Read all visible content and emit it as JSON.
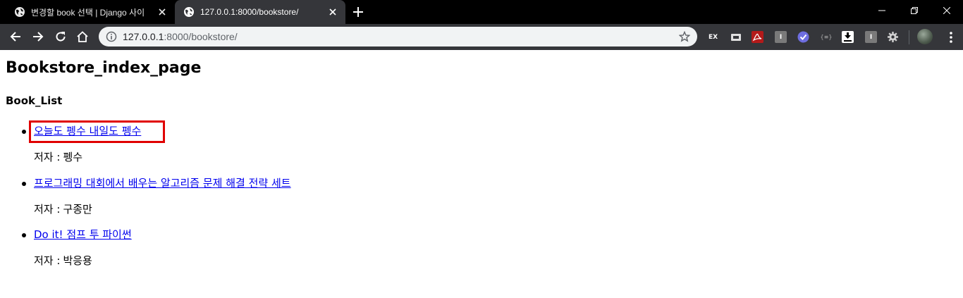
{
  "tabs": [
    {
      "title": "변경할 book 선택 | Django 사이",
      "active": false
    },
    {
      "title": "127.0.0.1:8000/bookstore/",
      "active": true
    }
  ],
  "address_bar": {
    "host": "127.0.0.1",
    "path": ":8000/bookstore/"
  },
  "extensions": [
    {
      "icon": "ex-extension-icon",
      "label": "EX",
      "color": "#e8691f"
    },
    {
      "icon": "screen-extension-icon",
      "label": "",
      "color": "#bdbdbd"
    },
    {
      "icon": "pdf-extension-icon",
      "label": "",
      "color": "#b41a1a"
    },
    {
      "icon": "info-extension-icon",
      "label": "I",
      "color": "#7a7a7a"
    },
    {
      "icon": "check-extension-icon",
      "label": "",
      "color": "#6e6ee0"
    },
    {
      "icon": "braces-extension-icon",
      "label": "{≡}",
      "color": "#35363a"
    },
    {
      "icon": "download-extension-icon",
      "label": "",
      "color": "#ffffff"
    },
    {
      "icon": "info-extension-icon-2",
      "label": "I",
      "color": "#7a7a7a"
    },
    {
      "icon": "gear-extension-icon",
      "label": "",
      "color": "#cfcfcf"
    }
  ],
  "page": {
    "heading": "Bookstore_index_page",
    "subheading": "Book_List",
    "author_label": "저자 :",
    "books": [
      {
        "title": "오늘도 펭수 내일도 펭수",
        "author": "펭수"
      },
      {
        "title": "프로그래밍 대회에서 배우는 알고리즘 문제 해결 전략 세트",
        "author": "구종만"
      },
      {
        "title": "Do it! 점프 투 파이썬",
        "author": "박응용"
      }
    ]
  },
  "colors": {
    "link": "#0000ee",
    "highlight": "#e00000",
    "tab_bar": "#000000",
    "toolbar": "#35363a"
  }
}
